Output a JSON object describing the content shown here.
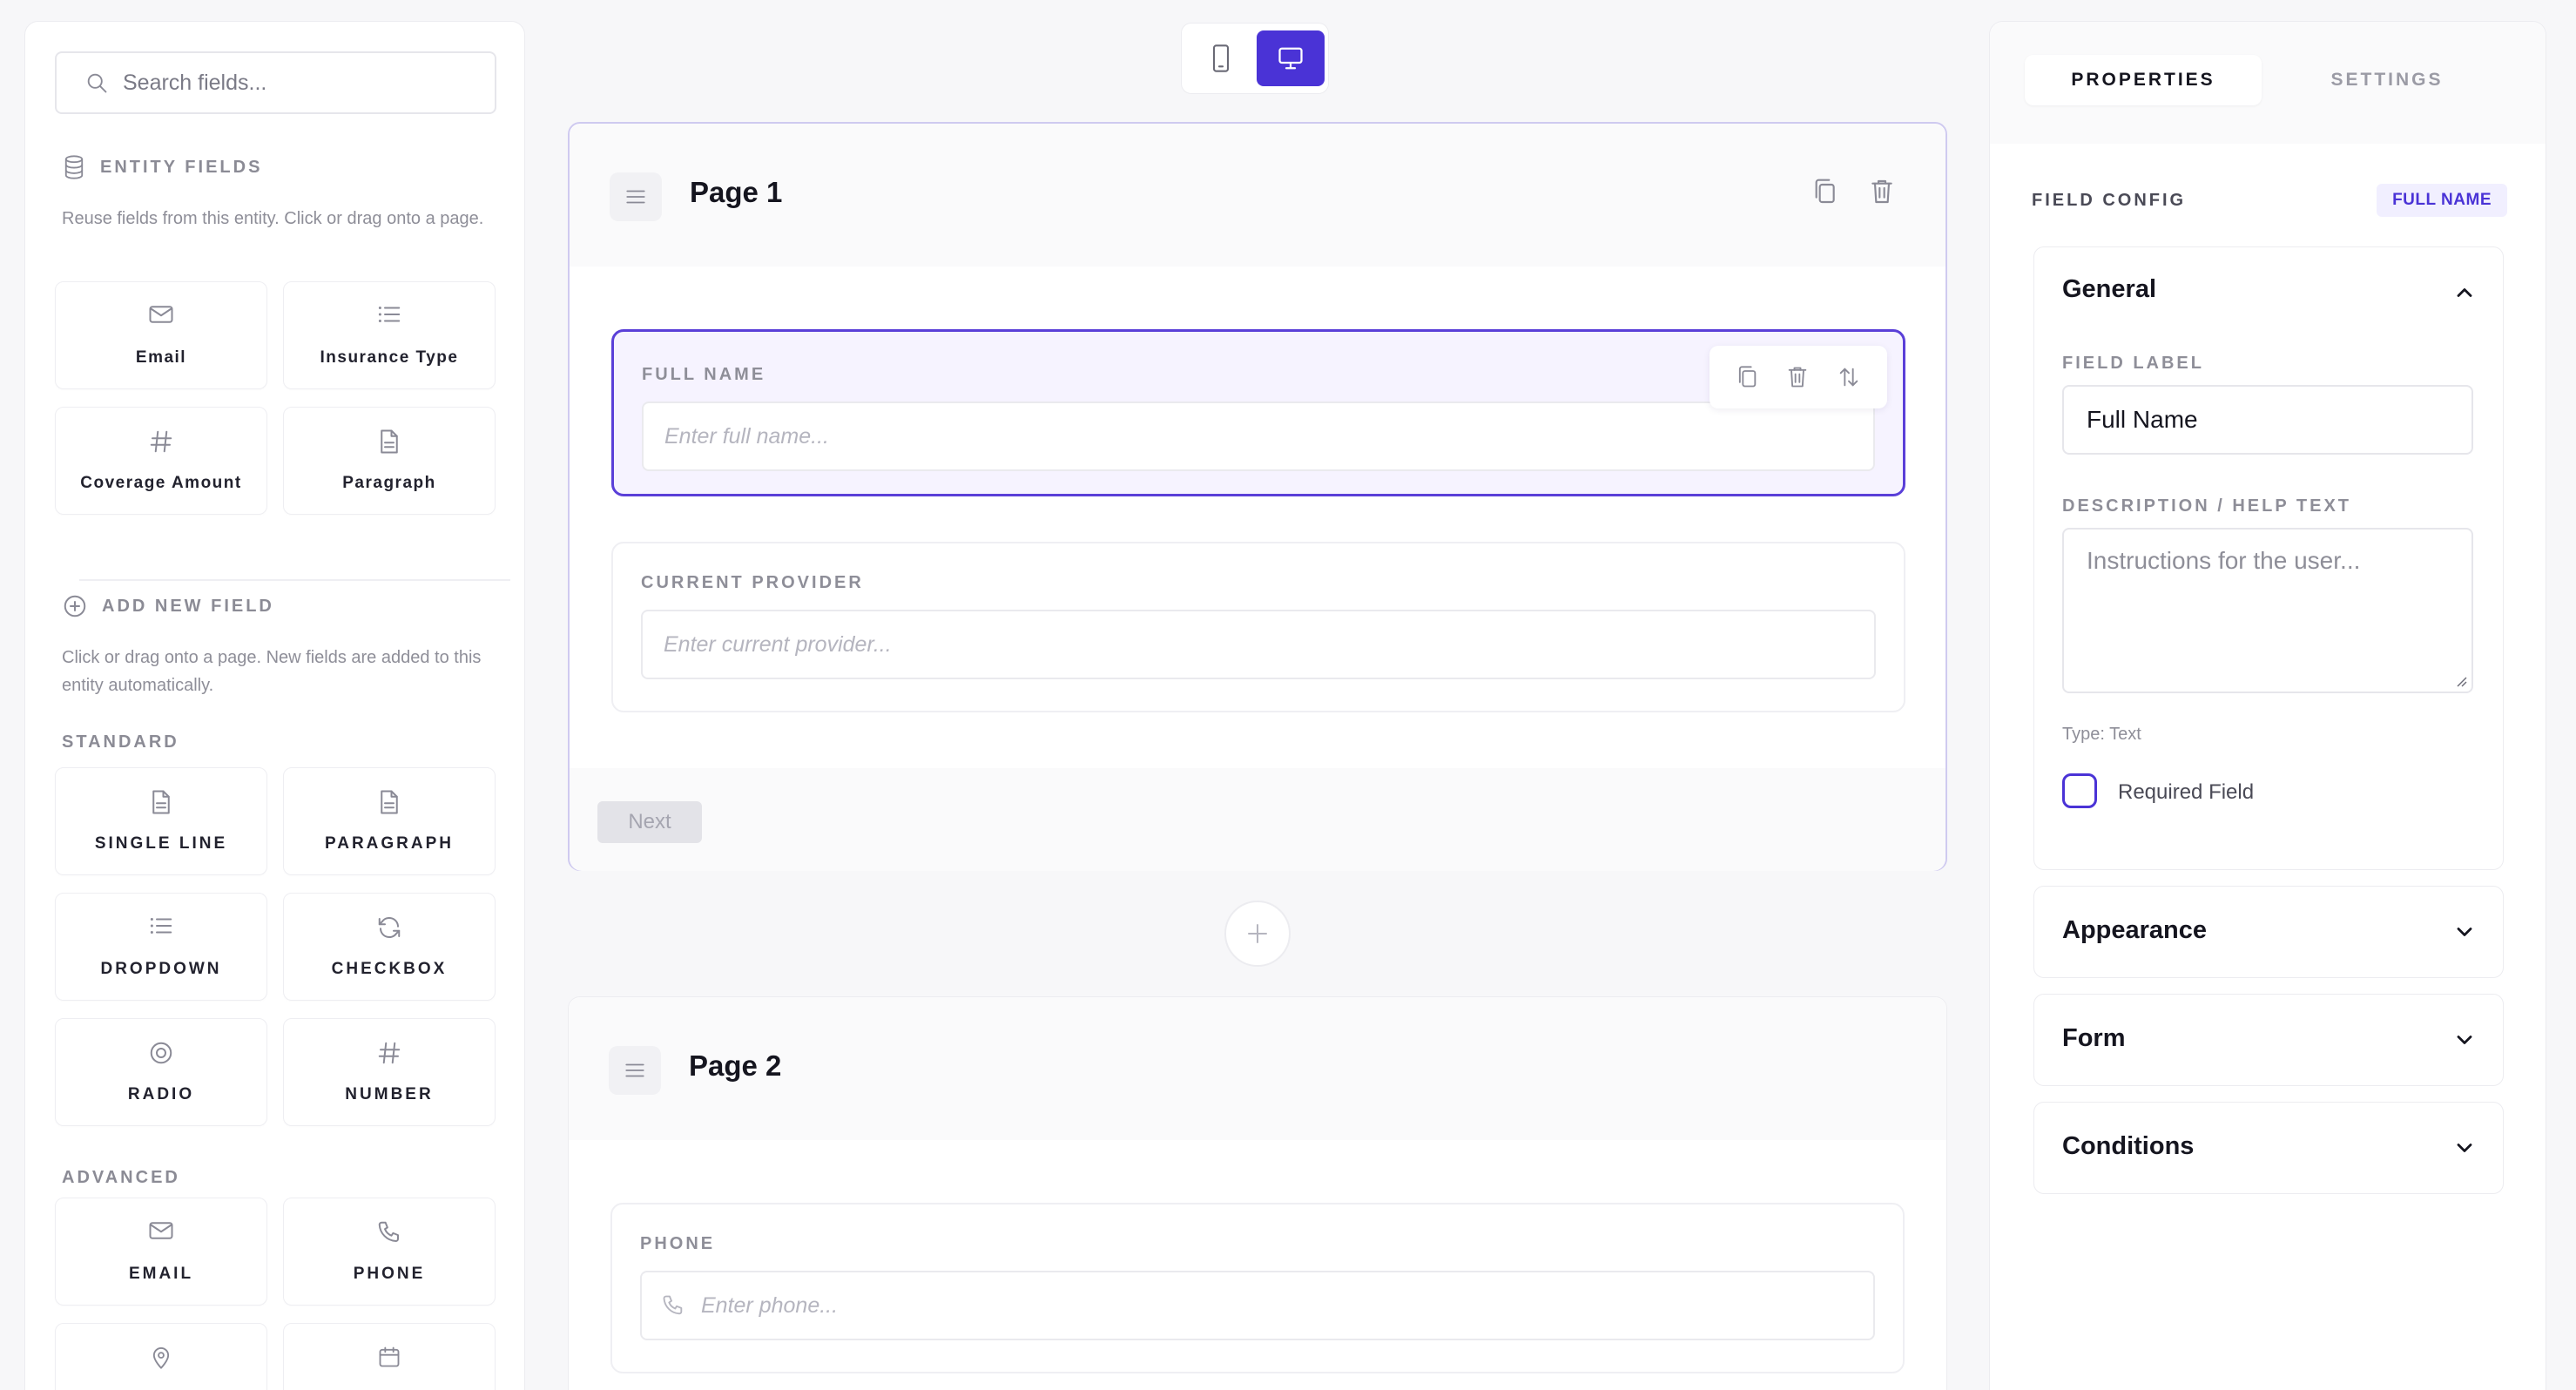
{
  "left_panel": {
    "search_placeholder": "Search fields...",
    "entity_fields": {
      "title": "ENTITY FIELDS",
      "description": "Reuse fields from this entity. Click or drag onto a page.",
      "tiles": [
        {
          "label": "Email",
          "icon": "mail-icon"
        },
        {
          "label": "Insurance Type",
          "icon": "list-icon"
        },
        {
          "label": "Coverage Amount",
          "icon": "hash-icon"
        },
        {
          "label": "Paragraph",
          "icon": "document-icon"
        }
      ]
    },
    "add_new_field": {
      "title": "ADD NEW FIELD",
      "description": "Click or drag onto a page. New fields are added to this entity automatically.",
      "standard_label": "STANDARD",
      "standard": [
        {
          "label": "SINGLE LINE",
          "icon": "document-icon"
        },
        {
          "label": "PARAGRAPH",
          "icon": "document-icon"
        },
        {
          "label": "DROPDOWN",
          "icon": "list-icon"
        },
        {
          "label": "CHECKBOX",
          "icon": "refresh-icon"
        },
        {
          "label": "RADIO",
          "icon": "radio-icon"
        },
        {
          "label": "NUMBER",
          "icon": "hash-icon"
        }
      ],
      "advanced_label": "ADVANCED",
      "advanced": [
        {
          "label": "EMAIL",
          "icon": "mail-icon"
        },
        {
          "label": "PHONE",
          "icon": "phone-icon"
        },
        {
          "label": "",
          "icon": "location-icon"
        },
        {
          "label": "",
          "icon": "calendar-icon"
        }
      ]
    }
  },
  "device_toggle": {
    "options": [
      "mobile",
      "desktop"
    ],
    "selected": "desktop"
  },
  "canvas": {
    "pages": [
      {
        "title": "Page 1",
        "fields": [
          {
            "label": "FULL NAME",
            "placeholder": "Enter full name...",
            "selected": true
          },
          {
            "label": "CURRENT PROVIDER",
            "placeholder": "Enter current provider...",
            "selected": false
          }
        ],
        "next_label": "Next"
      },
      {
        "title": "Page 2",
        "fields": [
          {
            "label": "PHONE",
            "placeholder": "Enter phone...",
            "selected": false
          }
        ]
      }
    ]
  },
  "right_panel": {
    "tabs": [
      "PROPERTIES",
      "SETTINGS"
    ],
    "active_tab": "PROPERTIES",
    "field_config_label": "FIELD CONFIG",
    "field_badge": "FULL NAME",
    "sections": {
      "general": {
        "title": "General",
        "expanded": true,
        "field_label_caption": "FIELD LABEL",
        "field_label_value": "Full Name",
        "description_caption": "DESCRIPTION / HELP TEXT",
        "description_placeholder": "Instructions for the user...",
        "type_text": "Type: Text",
        "required_label": "Required Field",
        "required_checked": false
      },
      "appearance": {
        "title": "Appearance",
        "expanded": false
      },
      "form": {
        "title": "Form",
        "expanded": false
      },
      "conditions": {
        "title": "Conditions",
        "expanded": false
      }
    }
  },
  "colors": {
    "accent": "#4a33d6",
    "selected_bg": "#f6f3ff",
    "muted_text": "#8e8e98"
  }
}
